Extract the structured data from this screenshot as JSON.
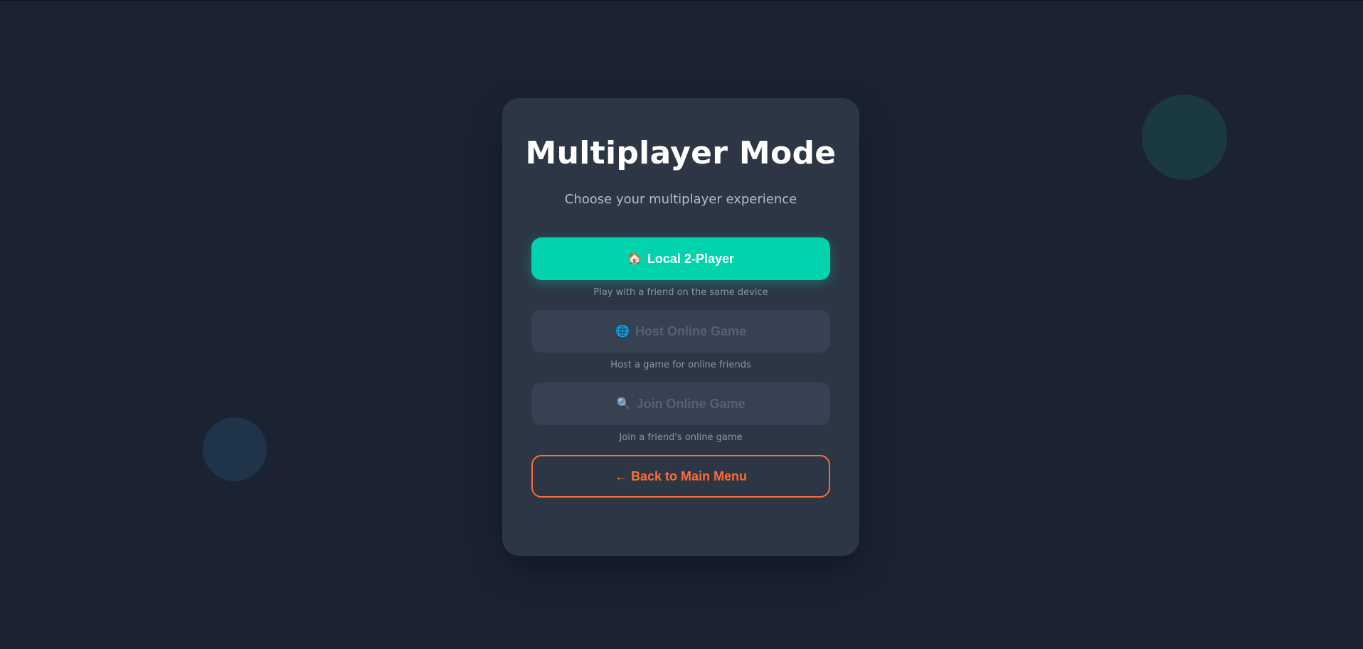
{
  "screen": {
    "title": "Multiplayer Mode",
    "subtitle": "Choose your multiplayer experience"
  },
  "options": {
    "local": {
      "icon": "house-icon",
      "glyph": "🏠",
      "label": "Local 2-Player",
      "description": "Play with a friend on the same device",
      "enabled": true
    },
    "host": {
      "icon": "globe-icon",
      "glyph": "🌐",
      "label": "Host Online Game",
      "description": "Host a game for online friends",
      "enabled": false
    },
    "join": {
      "icon": "search-icon",
      "glyph": "🔍",
      "label": "Join Online Game",
      "description": "Join a friend's online game",
      "enabled": false
    }
  },
  "back": {
    "label": "← Back to Main Menu"
  },
  "colors": {
    "background": "#1b2333",
    "card": "#2c3644",
    "primary": "#00d3ad",
    "accent": "#ff6b35",
    "disabled": "#364152"
  }
}
